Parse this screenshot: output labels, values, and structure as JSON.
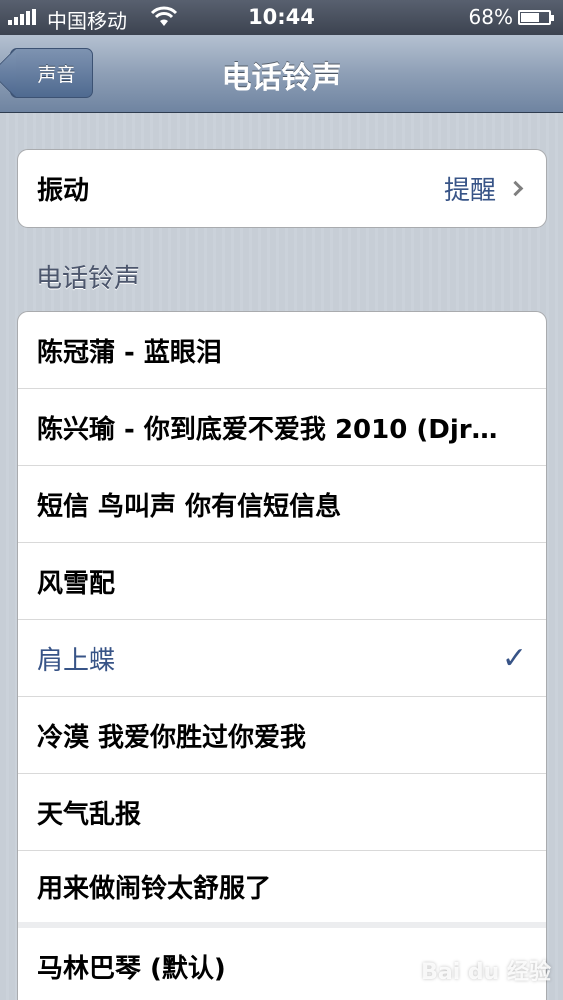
{
  "status_bar": {
    "carrier": "中国移动",
    "time": "10:44",
    "battery_percent": "68%",
    "battery_level": 0.68
  },
  "nav": {
    "back_label": "声音",
    "title": "电话铃声"
  },
  "vibration": {
    "label": "振动",
    "value": "提醒"
  },
  "section_header": "电话铃声",
  "ringtones": [
    {
      "label": "陈冠蒲 - 蓝眼泪",
      "selected": false
    },
    {
      "label": "陈兴瑜 - 你到底爱不爱我 2010 (Djr…",
      "selected": false
    },
    {
      "label": "短信 鸟叫声 你有信短信息",
      "selected": false
    },
    {
      "label": "风雪配",
      "selected": false
    },
    {
      "label": "肩上蝶",
      "selected": true
    },
    {
      "label": "冷漠 我爱你胜过你爱我",
      "selected": false
    },
    {
      "label": "天气乱报",
      "selected": false
    },
    {
      "label": "用来做闹铃太舒服了",
      "selected": false
    },
    {
      "label": "马林巴琴 (默认)",
      "selected": false
    }
  ],
  "watermark": "Bai du 经验",
  "colors": {
    "accent": "#385487",
    "nav_top": "#b5c1d1",
    "nav_bottom": "#6f84a1",
    "background": "#c5ccd4"
  }
}
